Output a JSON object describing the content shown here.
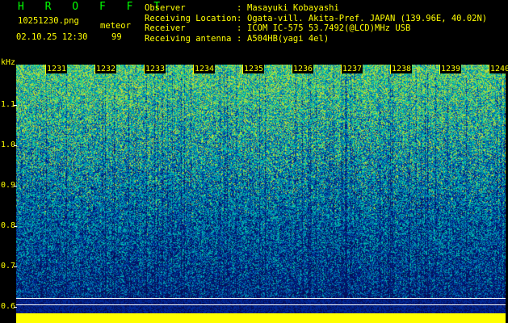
{
  "header": {
    "title": "H R O F F T",
    "filename": "10251230.png",
    "timestamp": "02.10.25 12:30",
    "meteor_label": "meteor",
    "meteor_count": "99"
  },
  "info": {
    "rows": [
      {
        "label": "Observer",
        "value": "Masayuki Kobayashi"
      },
      {
        "label": "Receiving Location",
        "value": "Ogata-vill. Akita-Pref. JAPAN (139.96E, 40.02N)"
      },
      {
        "label": "Receiver",
        "value": "ICOM IC-575 53.7492(@LCD)MHz USB"
      },
      {
        "label": "Receiving antenna",
        "value": "A504HB(yagi 4el)"
      }
    ],
    "separator": ":"
  },
  "spectrogram": {
    "y_unit": "kHz",
    "y_ticks": [
      "1.1",
      "1.0",
      "0.9",
      "0.8",
      "0.7",
      "0.6"
    ],
    "x_minutes": [
      "1231",
      "1232",
      "1233",
      "1234",
      "1235",
      "1236",
      "1237",
      "1238",
      "1239",
      "1240"
    ]
  },
  "colors": {
    "text": "#ffff00",
    "title": "#00ff00",
    "background": "#000000"
  }
}
